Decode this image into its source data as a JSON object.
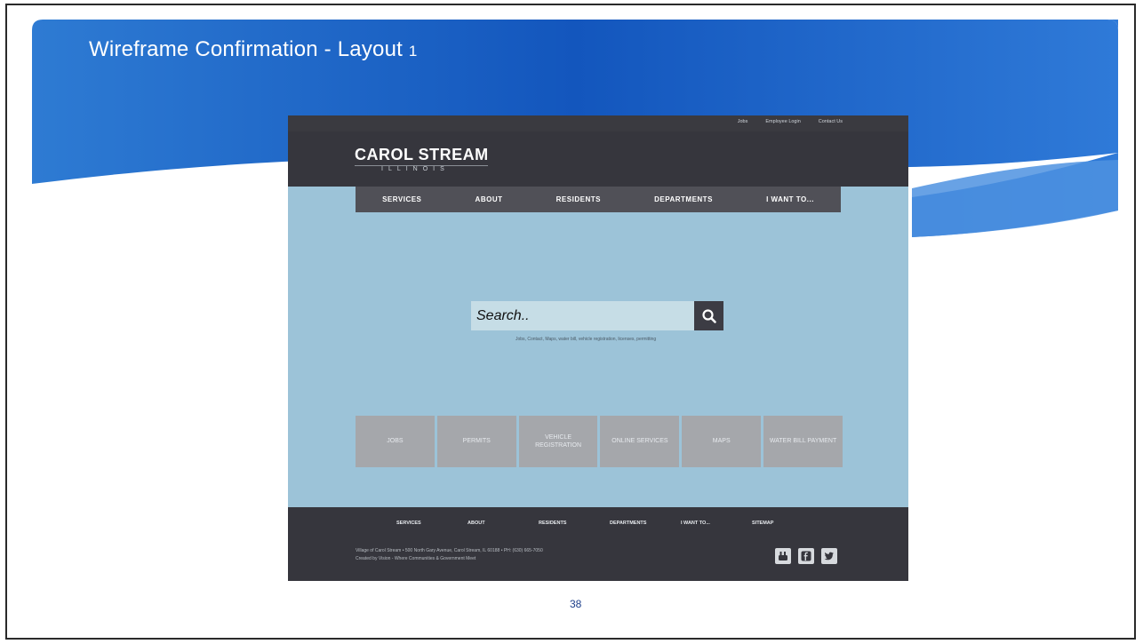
{
  "slide": {
    "title": "Wireframe Confirmation - Layout",
    "title_number": "1",
    "page_number": "38"
  },
  "site": {
    "top_links": [
      "Jobs",
      "Employee Login",
      "Contact Us"
    ],
    "logo_name": "CAROL STREAM",
    "logo_sub": "ILLINOIS",
    "nav": [
      "SERVICES",
      "ABOUT",
      "RESIDENTS",
      "DEPARTMENTS",
      "I WANT TO..."
    ],
    "search": {
      "placeholder": "Search..",
      "hint": "Jobs, Contact, Maps, water bill, vehicle registration, licenses, permitting"
    },
    "quick_links": [
      "JOBS",
      "PERMITS",
      "VEHICLE REGISTRATION",
      "ONLINE SERVICES",
      "MAPS",
      "WATER BILL PAYMENT"
    ],
    "footer": {
      "nav": [
        "SERVICES",
        "ABOUT",
        "RESIDENTS",
        "DEPARTMENTS",
        "I WANT TO...",
        "SITEMAP"
      ],
      "address_line": "Village of Carol Stream  •  500 North Gary Avenue, Carol Stream, IL 60188  •  PH: (630) 665-7050",
      "credit_line": "Created by Vision - Where Communities & Government Meet"
    }
  },
  "colors": {
    "banner_blue": "#1f63c2",
    "site_dark": "#36363d",
    "site_body": "#9cc3d8",
    "tile_gray": "#a5a7ab"
  }
}
